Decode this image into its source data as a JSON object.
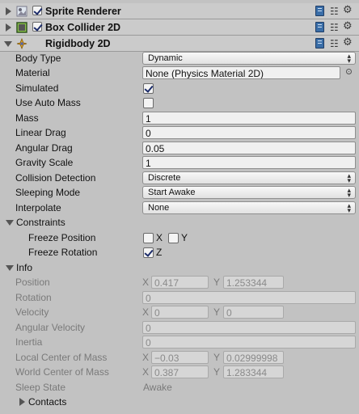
{
  "components": {
    "sprite_renderer": {
      "title": "Sprite Renderer",
      "enabled": true
    },
    "box_collider": {
      "title": "Box Collider 2D",
      "enabled": true
    },
    "rigidbody": {
      "title": "Rigidbody 2D"
    }
  },
  "props": {
    "body_type": {
      "label": "Body Type",
      "value": "Dynamic"
    },
    "material": {
      "label": "Material",
      "value": "None (Physics Material 2D)"
    },
    "simulated": {
      "label": "Simulated",
      "checked": true
    },
    "use_auto_mass": {
      "label": "Use Auto Mass",
      "checked": false
    },
    "mass": {
      "label": "Mass",
      "value": "1"
    },
    "linear_drag": {
      "label": "Linear Drag",
      "value": "0"
    },
    "angular_drag": {
      "label": "Angular Drag",
      "value": "0.05"
    },
    "gravity_scale": {
      "label": "Gravity Scale",
      "value": "1"
    },
    "collision_detection": {
      "label": "Collision Detection",
      "value": "Discrete"
    },
    "sleeping_mode": {
      "label": "Sleeping Mode",
      "value": "Start Awake"
    },
    "interpolate": {
      "label": "Interpolate",
      "value": "None"
    }
  },
  "constraints": {
    "label": "Constraints",
    "freeze_position": {
      "label": "Freeze Position",
      "x_label": "X",
      "y_label": "Y",
      "x_checked": false,
      "y_checked": false
    },
    "freeze_rotation": {
      "label": "Freeze Rotation",
      "z_label": "Z",
      "z_checked": true
    }
  },
  "info": {
    "label": "Info",
    "x_label": "X",
    "y_label": "Y",
    "position": {
      "label": "Position",
      "x": "0.417",
      "y": "1.253344"
    },
    "rotation": {
      "label": "Rotation",
      "value": "0"
    },
    "velocity": {
      "label": "Velocity",
      "x": "0",
      "y": "0"
    },
    "angular_velocity": {
      "label": "Angular Velocity",
      "value": "0"
    },
    "inertia": {
      "label": "Inertia",
      "value": "0"
    },
    "local_com": {
      "label": "Local Center of Mass",
      "x": "−0.03",
      "y": "0.02999998"
    },
    "world_com": {
      "label": "World Center of Mass",
      "x": "0.387",
      "y": "1.283344"
    },
    "sleep_state": {
      "label": "Sleep State",
      "value": "Awake"
    },
    "contacts": {
      "label": "Contacts"
    }
  },
  "icons": {
    "dropdown_arrows": "▲▼",
    "sliders": "☷",
    "gear": "⚙"
  }
}
